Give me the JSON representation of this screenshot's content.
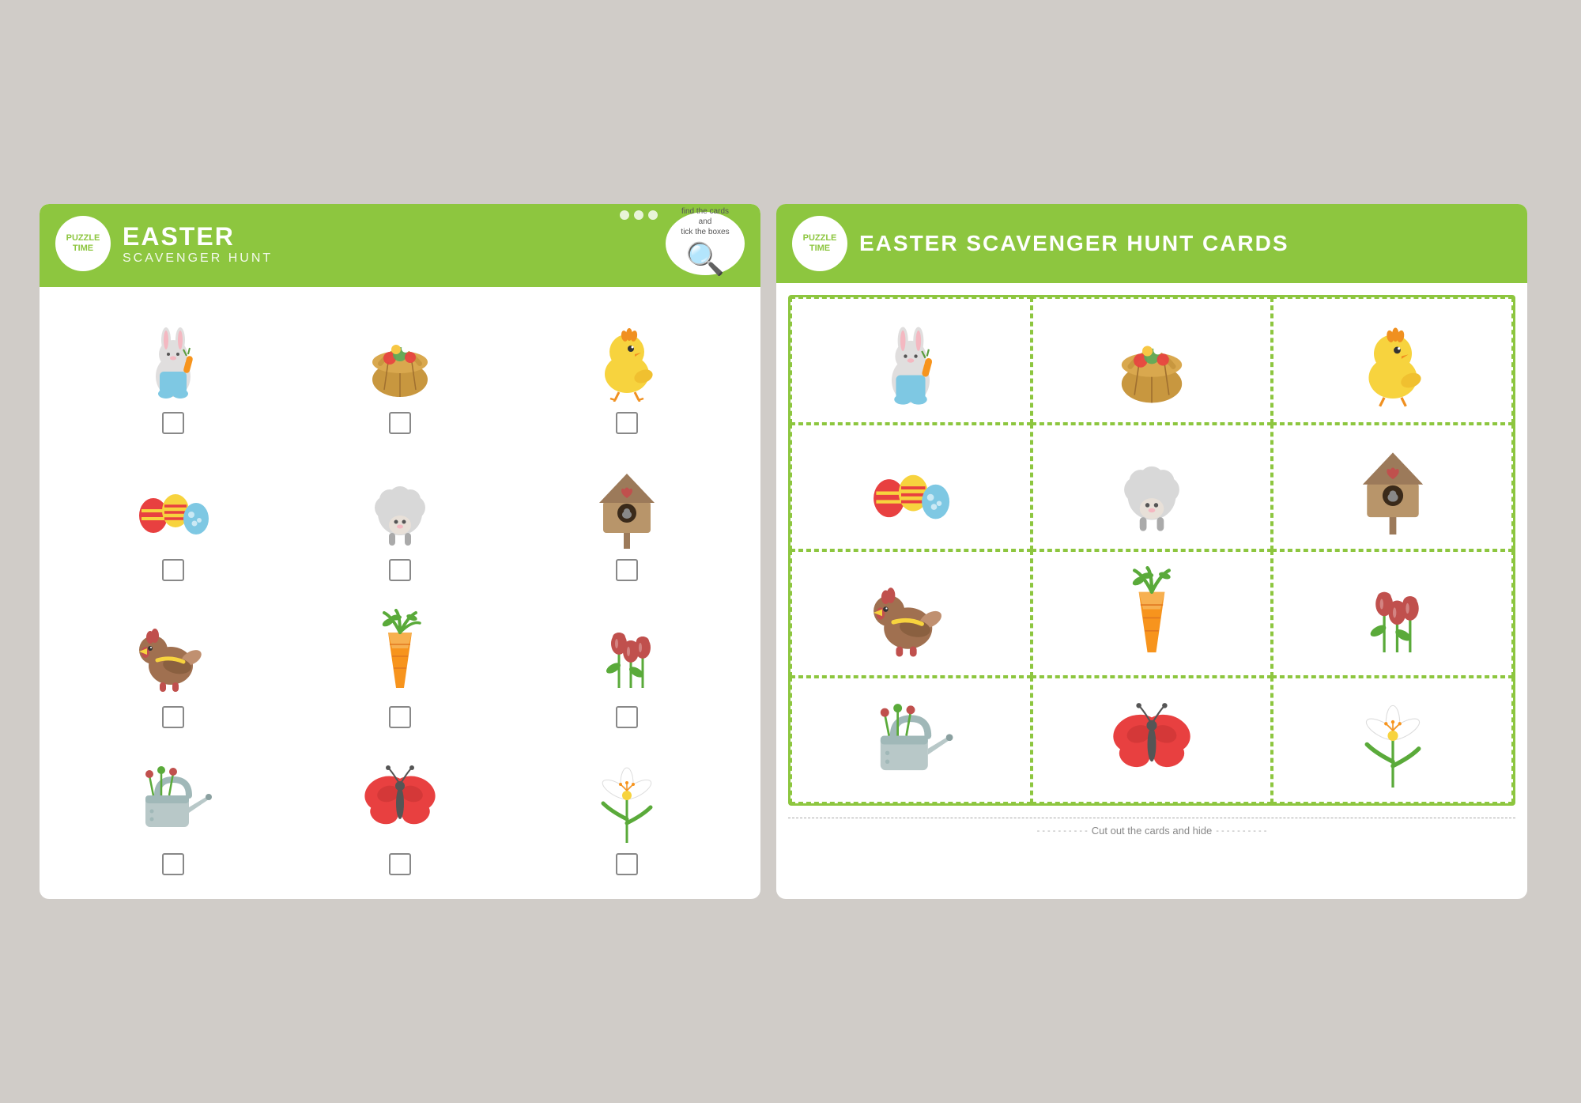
{
  "left": {
    "badge": {
      "line1": "PUZZLE",
      "line2": "TIME"
    },
    "title": {
      "main": "EASTER",
      "sub": "SCAVENGER HUNT"
    },
    "magnifier": {
      "text": "find the cards and tick the boxes"
    },
    "items": [
      {
        "id": "bunny",
        "emoji": "🐇",
        "label": "Easter Bunny"
      },
      {
        "id": "basket",
        "emoji": "🧺",
        "label": "Flower Basket"
      },
      {
        "id": "chick",
        "emoji": "🐥",
        "label": "Yellow Chick"
      },
      {
        "id": "eggs",
        "emoji": "🥚",
        "label": "Easter Eggs"
      },
      {
        "id": "sheep",
        "emoji": "🐑",
        "label": "Sheep"
      },
      {
        "id": "birdhouse",
        "emoji": "🏠",
        "label": "Birdhouse"
      },
      {
        "id": "hen",
        "emoji": "🐔",
        "label": "Hen"
      },
      {
        "id": "carrot",
        "emoji": "🥕",
        "label": "Carrot"
      },
      {
        "id": "flowers",
        "emoji": "🌺",
        "label": "Flowers"
      },
      {
        "id": "watering-can",
        "emoji": "🪣",
        "label": "Watering Can"
      },
      {
        "id": "butterfly",
        "emoji": "🦋",
        "label": "Butterfly"
      },
      {
        "id": "lily",
        "emoji": "🌸",
        "label": "Lily"
      }
    ]
  },
  "right": {
    "badge": {
      "line1": "PUZZLE",
      "line2": "TIME"
    },
    "title": "EASTER SCAVENGER HUNT CARDS",
    "cut_line": "Cut out the cards and hide",
    "cards": [
      {
        "id": "bunny",
        "emoji": "🐇",
        "label": "Easter Bunny"
      },
      {
        "id": "basket",
        "emoji": "🧺",
        "label": "Flower Basket"
      },
      {
        "id": "chick",
        "emoji": "🐥",
        "label": "Yellow Chick"
      },
      {
        "id": "eggs",
        "emoji": "🥚",
        "label": "Easter Eggs"
      },
      {
        "id": "sheep",
        "emoji": "🐑",
        "label": "Sheep"
      },
      {
        "id": "birdhouse",
        "emoji": "🏠",
        "label": "Birdhouse"
      },
      {
        "id": "hen",
        "emoji": "🐔",
        "label": "Hen"
      },
      {
        "id": "carrot",
        "emoji": "🥕",
        "label": "Carrot"
      },
      {
        "id": "flowers",
        "emoji": "🌺",
        "label": "Flowers"
      },
      {
        "id": "watering-can",
        "emoji": "🪣",
        "label": "Watering Can"
      },
      {
        "id": "butterfly",
        "emoji": "🦋",
        "label": "Butterfly"
      },
      {
        "id": "lily",
        "emoji": "🌸",
        "label": "Lily"
      }
    ]
  }
}
